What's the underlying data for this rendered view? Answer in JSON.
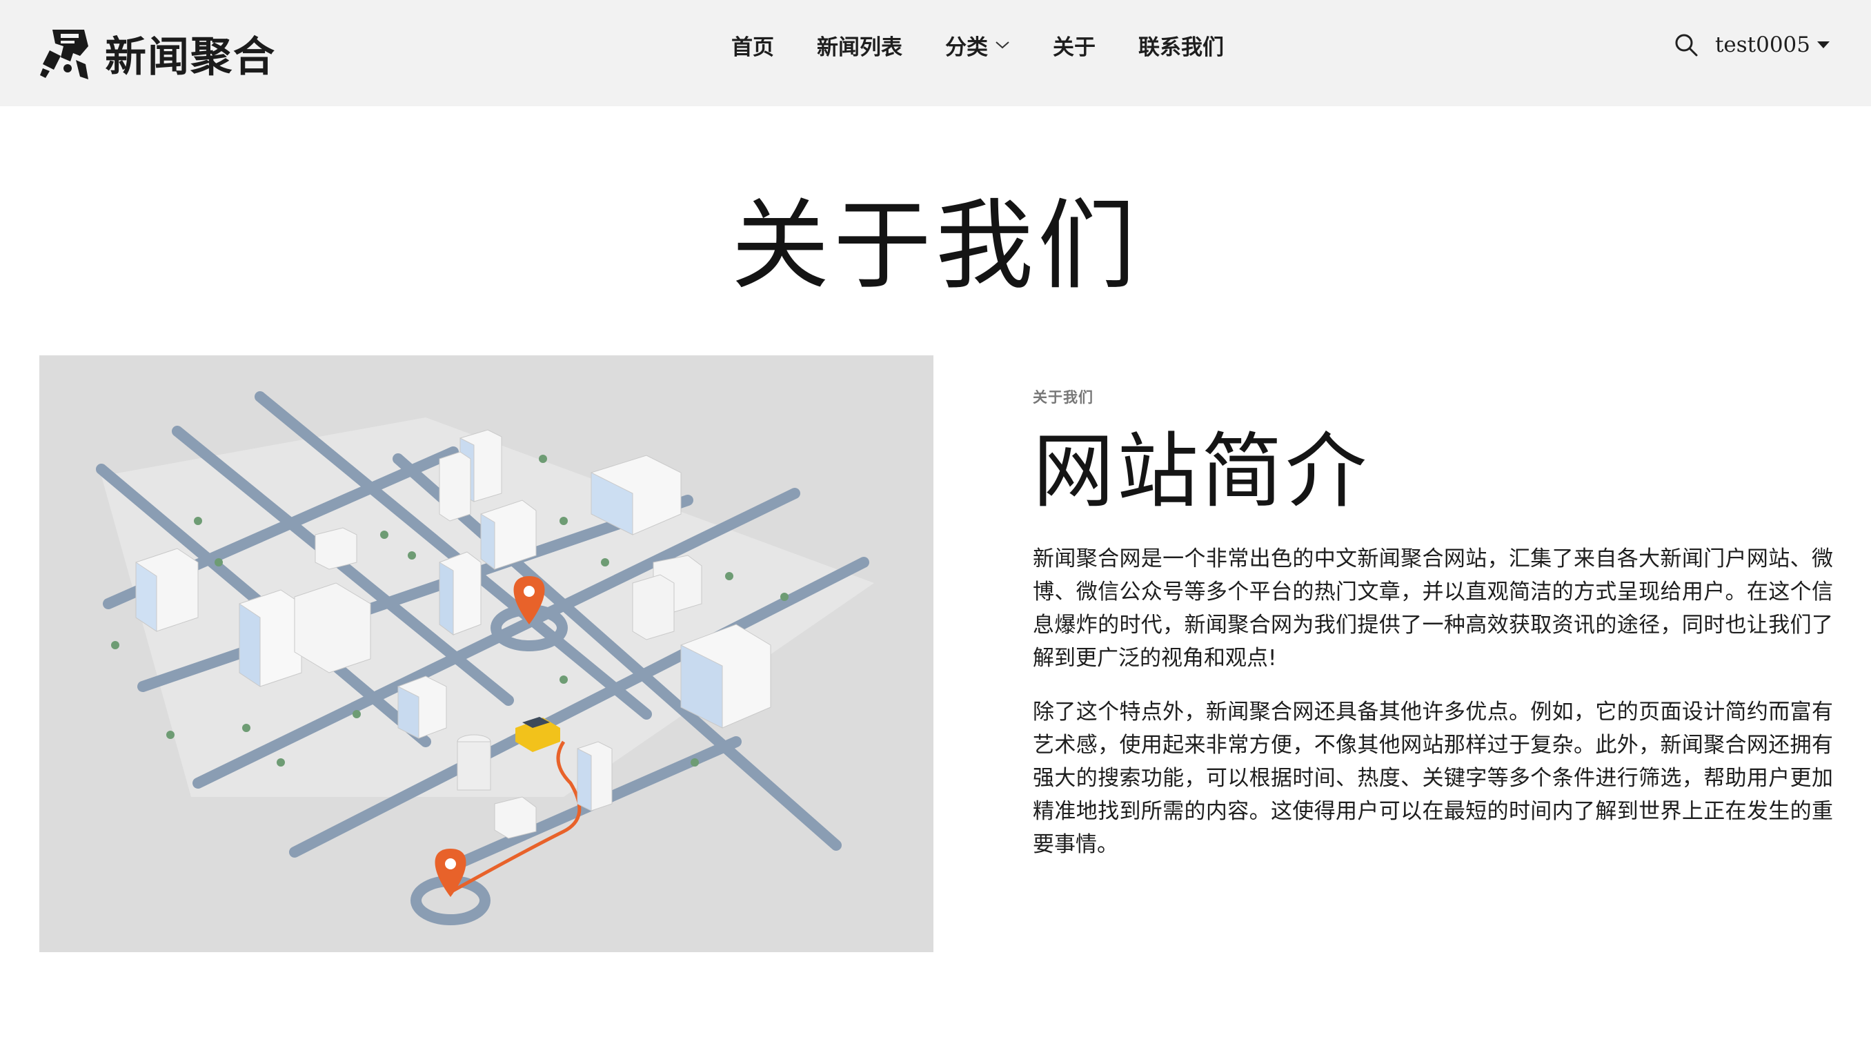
{
  "brand": {
    "name": "新闻聚合",
    "logo_icon": "news-stamp-logo"
  },
  "nav": {
    "items": [
      {
        "label": "首页"
      },
      {
        "label": "新闻列表"
      },
      {
        "label": "分类",
        "has_dropdown": true
      },
      {
        "label": "关于"
      },
      {
        "label": "联系我们"
      }
    ],
    "search_icon": "search-icon",
    "user": "test0005"
  },
  "page": {
    "title": "关于我们"
  },
  "about": {
    "eyebrow": "关于我们",
    "title": "网站简介",
    "paragraphs": [
      "新闻聚合网是一个非常出色的中文新闻聚合网站，汇集了来自各大新闻门户网站、微博、微信公众号等多个平台的热门文章，并以直观简洁的方式呈现给用户。在这个信息爆炸的时代，新闻聚合网为我们提供了一种高效获取资讯的途径，同时也让我们了解到更广泛的视角和观点!",
      "除了这个特点外，新闻聚合网还具备其他许多优点。例如，它的页面设计简约而富有艺术感，使用起来非常方便，不像其他网站那样过于复杂。此外，新闻聚合网还拥有强大的搜索功能，可以根据时间、热度、关键字等多个条件进行筛选，帮助用户更加精准地找到所需的内容。这使得用户可以在最短的时间内了解到世界上正在发生的重要事情。"
    ]
  },
  "image": {
    "subject": "isometric-city-map-illustration"
  },
  "colors": {
    "header_bg": "#f2f2f2",
    "image_bg": "#dcdcdc",
    "road": "#8a9db3",
    "pin": "#e8622a",
    "taxi": "#f2c21b"
  }
}
